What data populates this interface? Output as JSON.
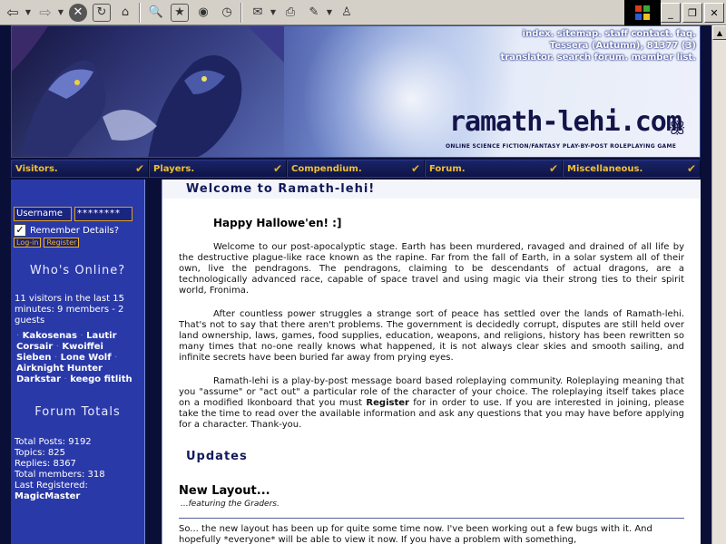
{
  "banner": {
    "links_line1": [
      "index.",
      "sitemap.",
      "staff contact.",
      "faq."
    ],
    "date_line": "Tessera (Autumn), 81377 (3)",
    "links_line3": [
      "translator.",
      "search forum.",
      "member list."
    ],
    "logo": "ramath-lehi.com",
    "tagline": "ONLINE SCIENCE FICTION/FANTASY PLAY-BY-POST ROLEPLAYING GAME"
  },
  "nav": [
    {
      "label": "Visitors."
    },
    {
      "label": "Players."
    },
    {
      "label": "Compendium."
    },
    {
      "label": "Forum."
    },
    {
      "label": "Miscellaneous."
    }
  ],
  "sidebar": {
    "username_value": "Username",
    "password_value": "********",
    "remember_label": "Remember Details?",
    "login_btn": "Log-in",
    "register_btn": "Register",
    "whos_online_title": "Who's Online?",
    "whos_online_text": "11 visitors in the last 15 minutes: 9 members - 2 guests",
    "members": [
      "Kakosenas",
      "Lautir",
      "Corsair",
      "Kwoiffei",
      "Sieben",
      "Lone Wolf",
      "Airknight Hunter",
      "Darkstar",
      "keego fitlith"
    ],
    "totals_title": "Forum Totals",
    "total_posts": "Total Posts: 9192",
    "topics": "Topics: 825",
    "replies": "Replies: 8367",
    "total_members": "Total members: 318",
    "last_registered_label": "Last Registered:",
    "last_registered": "MagicMaster"
  },
  "main": {
    "welcome_title": "Welcome to Ramath-lehi!",
    "halloween": "Happy Hallowe'en! :]",
    "para1": "Welcome to our post-apocalyptic stage. Earth has been murdered, ravaged and drained of all life by the destructive plague-like race known as the rapine. Far from the fall of Earth, in a solar system all of their own, live the pendragons. The pendragons, claiming to be descendants of actual dragons, are a technologically advanced race, capable of space travel and using magic via their strong ties to their spirit world, Fronima.",
    "para2": "After countless power struggles a strange sort of peace has settled over the lands of Ramath-lehi. That's not to say that there aren't problems. The government is decidedly corrupt, disputes are still held over land ownership, laws, games, food supplies, education, weapons, and religions, history has been rewritten so many times that no-one really knows what happened, it is not always clear skies and smooth sailing, and infinite secrets have been buried far away from prying eyes.",
    "para3_a": "Ramath-lehi is a play-by-post message board based roleplaying community. Roleplaying meaning that you \"assume\" or \"act out\" a particular role of the character of your choice. The roleplaying itself takes place on a modified Ikonboard that you must ",
    "para3_register": "Register",
    "para3_b": " for in order to use. If you are interested in joining, please take the time to read over the available information and ask any questions that you may have before applying for a character. Thank-you.",
    "updates_title": "Updates",
    "post_title": "New Layout...",
    "post_sub": "...featuring the Graders.",
    "post_body": "So... the new layout has been up for quite some time now. I've been working out a few bugs with it. And hopefully *everyone* will be able to view it now. If you have a problem with something,"
  },
  "colors": {
    "nav_text": "#f0c030",
    "sidebar_bg": "#2a39a8",
    "page_bg": "#0a0f38"
  }
}
